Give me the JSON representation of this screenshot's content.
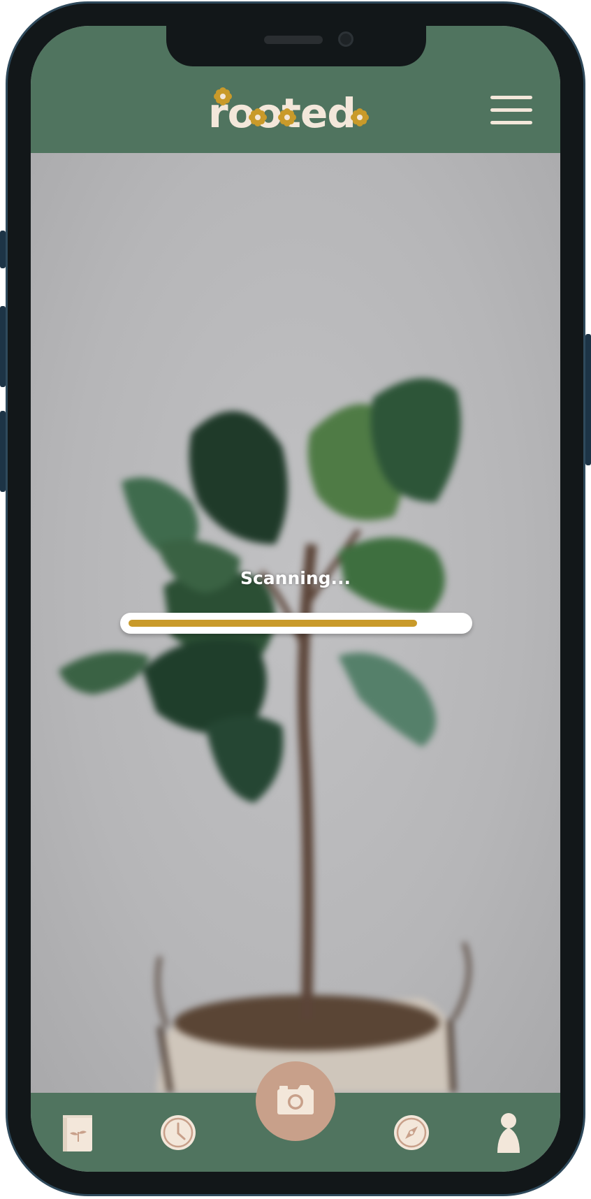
{
  "app": {
    "name": "rooted"
  },
  "header": {
    "logo_text": "rooted",
    "menu_icon": "hamburger-menu-icon"
  },
  "scanner": {
    "status_text": "Scanning...",
    "progress": 0.86
  },
  "bottom_nav": {
    "items": [
      {
        "id": "plant-journal",
        "icon": "plant-book-icon"
      },
      {
        "id": "history",
        "icon": "clock-icon"
      },
      {
        "id": "camera",
        "icon": "camera-icon"
      },
      {
        "id": "explore",
        "icon": "compass-icon"
      },
      {
        "id": "profile",
        "icon": "person-icon"
      }
    ]
  },
  "colors": {
    "header_bg": "#50745f",
    "cream": "#f3e7da",
    "gold": "#c99a2a",
    "camera_button": "#c8a08a",
    "phone_frame": "#121719"
  }
}
